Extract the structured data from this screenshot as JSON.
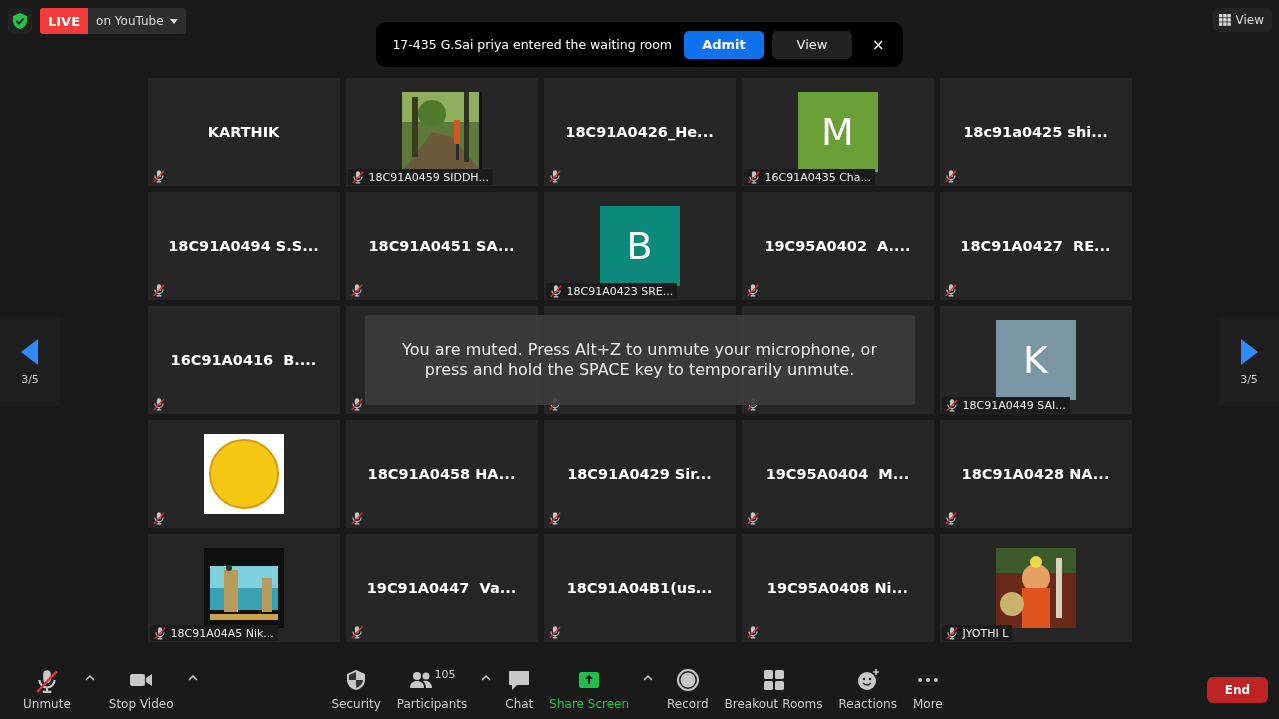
{
  "top_bar": {
    "live": {
      "badge": "LIVE",
      "platform": "on YouTube"
    },
    "view_button": "View"
  },
  "notification": {
    "message": "17-435 G.Sai priya entered the waiting room",
    "admit": "Admit",
    "view": "View",
    "close": "×"
  },
  "pager": {
    "left": "3/5",
    "right": "3/5"
  },
  "tiles": [
    {
      "kind": "name",
      "name": "KARTHIK",
      "muted": true
    },
    {
      "kind": "picture",
      "label": "18C91A0459 SIDDH...",
      "muted": true
    },
    {
      "kind": "name",
      "name": "18C91A0426_He...",
      "muted": true
    },
    {
      "kind": "avatar",
      "letter": "M",
      "color": "#6a9f37",
      "label": "16C91A0435 Cha...",
      "muted": true
    },
    {
      "kind": "name",
      "name": "18c91a0425 shi...",
      "muted": true
    },
    {
      "kind": "name",
      "name": "18C91A0494 S.S...",
      "muted": true
    },
    {
      "kind": "name",
      "name": "18C91A0451 SA...",
      "muted": true
    },
    {
      "kind": "avatar",
      "letter": "B",
      "color": "#0e8a7c",
      "label": "18C91A0423 SRE...",
      "muted": true
    },
    {
      "kind": "name",
      "name": "19C95A0402  A....",
      "muted": true
    },
    {
      "kind": "name",
      "name": "18C91A0427  RE...",
      "muted": true
    },
    {
      "kind": "name",
      "name": "16C91A0416  B....",
      "muted": true
    },
    {
      "kind": "name",
      "muted": true
    },
    {
      "kind": "name",
      "muted": true
    },
    {
      "kind": "name",
      "muted": true
    },
    {
      "kind": "avatar",
      "letter": "K",
      "color": "#7b96a4",
      "label": "18C91A0449 SAI...",
      "muted": true
    },
    {
      "kind": "picture",
      "muted": true
    },
    {
      "kind": "name",
      "name": "18C91A0458 HA...",
      "muted": true
    },
    {
      "kind": "name",
      "name": "18C91A0429 Sir...",
      "muted": true
    },
    {
      "kind": "name",
      "name": "19C95A0404  M...",
      "muted": true
    },
    {
      "kind": "name",
      "name": "18C91A0428 NA...",
      "muted": true
    },
    {
      "kind": "picture",
      "label": "18C91A04A5 Nik...",
      "muted": true
    },
    {
      "kind": "name",
      "name": "19C91A0447  Va...",
      "muted": true
    },
    {
      "kind": "name",
      "name": "18C91A04B1(us...",
      "muted": true
    },
    {
      "kind": "name",
      "name": "19C95A0408 Ni...",
      "muted": true
    },
    {
      "kind": "picture",
      "label": "JYOTHI L",
      "muted": true
    }
  ],
  "toast": "You are muted. Press Alt+Z to unmute your microphone, or press and hold the SPACE key to temporarily unmute.",
  "toolbar": [
    {
      "kind": "mic",
      "label": "Unmute",
      "muted": true,
      "menu": true
    },
    {
      "kind": "video",
      "label": "Stop Video",
      "menu": true
    },
    {
      "kind": "security",
      "label": "Security"
    },
    {
      "kind": "participants",
      "label": "Participants",
      "count": "105",
      "menu": true
    },
    {
      "kind": "chat",
      "label": "Chat"
    },
    {
      "kind": "share",
      "label": "Share Screen",
      "menu": true,
      "active": true
    },
    {
      "kind": "record",
      "label": "Record"
    },
    {
      "kind": "breakout",
      "label": "Breakout Rooms"
    },
    {
      "kind": "reactions",
      "label": "Reactions"
    },
    {
      "kind": "more",
      "label": "More"
    }
  ],
  "end_button": "End"
}
